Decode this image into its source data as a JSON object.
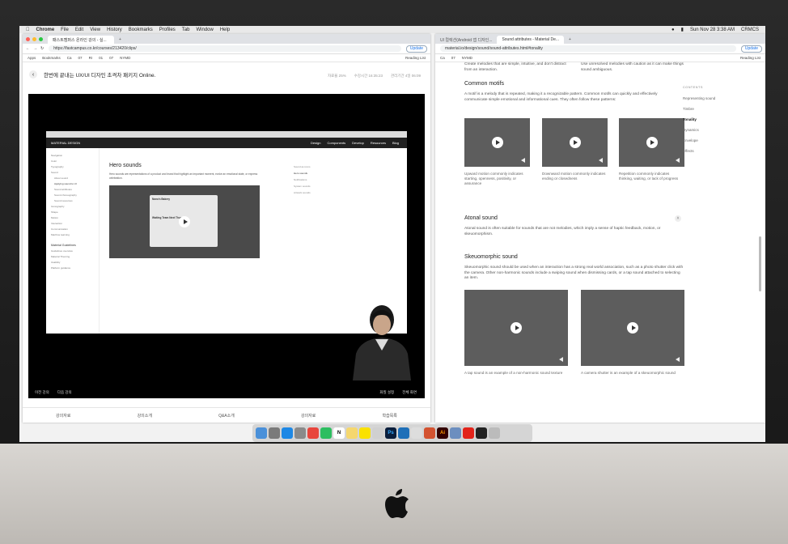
{
  "menubar": {
    "app": "Chrome",
    "items": [
      "File",
      "Edit",
      "View",
      "History",
      "Bookmarks",
      "Profiles",
      "Tab",
      "Window",
      "Help"
    ],
    "clock": "Sun Nov 28  3:38 AM",
    "user": "CRMCS"
  },
  "left": {
    "tabs": [
      "패스트캠퍼스 온라인 강의 - 실...",
      "·"
    ],
    "url": "https://fastcampus.co.kr/courses/213420/clips/",
    "update": "Update",
    "bookmarks": [
      "Apps",
      "Bookmarks",
      "Ca",
      "07",
      "RI",
      "01",
      "07",
      "NYMD",
      "Reading List"
    ],
    "course_title": "한번에 끝내는 UX/UI 디자인 초격차 패키지 Online.",
    "meta": [
      "자료율 25%",
      "수강시간 16:35:23",
      "관리기간 4일 06:09"
    ],
    "inner": {
      "brand": "MATERIAL DESIGN",
      "nav": [
        "Design",
        "Components",
        "Develop",
        "Resources",
        "Blog"
      ],
      "sidebar": [
        "Navigation",
        "Color",
        "Typography",
        "Sound",
        "About sound",
        "Applying sound to UI",
        "Sound attributes",
        "Sound choreography",
        "Sound resources",
        "Iconography",
        "Shape",
        "Motion",
        "Interaction",
        "Communication",
        "Machine learning",
        "Material Guidelines",
        "Guidelines overview",
        "Material Theming",
        "Usability",
        "Platform guidance"
      ],
      "heading": "Hero sounds",
      "body": "Hero sounds are representations of a product and brand that highlight an important moment, evoke an emotional state, or express celebration.",
      "card_title": "Nona's Bakery",
      "card_sub": "Waiting Team Next Thursday",
      "toc": [
        "Sound as icons",
        "Hero sounds",
        "Notifications",
        "System sounds",
        "Artwork sounds"
      ]
    },
    "controls": {
      "left": [
        "이전 강의",
        "다음 강의"
      ],
      "right": [
        "화질 설정",
        "전체 화면"
      ]
    },
    "bottom_tabs": [
      "강의자료",
      "강의소개",
      "Q&A소개",
      "강의자료",
      "학습목록"
    ]
  },
  "right": {
    "tabs": [
      "UI 컬렉션(Android 앱 디자인...",
      "Sound attributes - Material De..."
    ],
    "url": "material.io/design/sound/sound-attributes.html#tonality",
    "update": "Update",
    "top_left_text": "Create melodies that are simple, intuitive, and don't distract from an interaction.",
    "top_right_text": "Use unresolved melodies with caution as it can make things sound ambiguous.",
    "motifs": {
      "title": "Common motifs",
      "body": "A motif is a melody that is repeated, making it a recognizable pattern. Common motifs can quickly and effectively communicate simple emotional and informational cues. They often follow these patterns:",
      "captions": [
        "Upward motion commonly indicates starting, openness, positivity, or assurance",
        "Downward motion commonly indicates ending or closedness",
        "Repetition commonly indicates thinking, waiting, or lack of progress"
      ]
    },
    "atonal": {
      "title": "Atonal sound",
      "body": "Atonal sound is often suitable for sounds that are not melodies, which imply a sense of haptic feedback, motion, or skeuomorphism."
    },
    "skeuomorphic": {
      "title": "Skeuomorphic sound",
      "body": "Skeuomorphic sound should be used when an interaction has a strong real world association, such as a photo shutter click with the camera. Other non-harmonic sounds include a swiping sound when dismissing cards, or a tap sound attached to selecting an item.",
      "captions": [
        "A tap sound is an example of a non-harmonic sound texture",
        "A camera shutter is an example of a skeuomorphic sound"
      ]
    },
    "toc": {
      "label": "CONTENTS",
      "items": [
        "Representing sound",
        "Timbre",
        "Tonality",
        "Dynamics",
        "Envelope",
        "Effects"
      ]
    }
  },
  "dock_icons": [
    "finder",
    "launchpad",
    "app-store",
    "settings",
    "chrome",
    "evernote",
    "notion",
    "notes",
    "kakaotalk",
    "files",
    "photoshop",
    "vscode",
    "vlc",
    "powerpoint",
    "illustrator",
    "preview",
    "acrobat",
    "stocks",
    "trash"
  ]
}
